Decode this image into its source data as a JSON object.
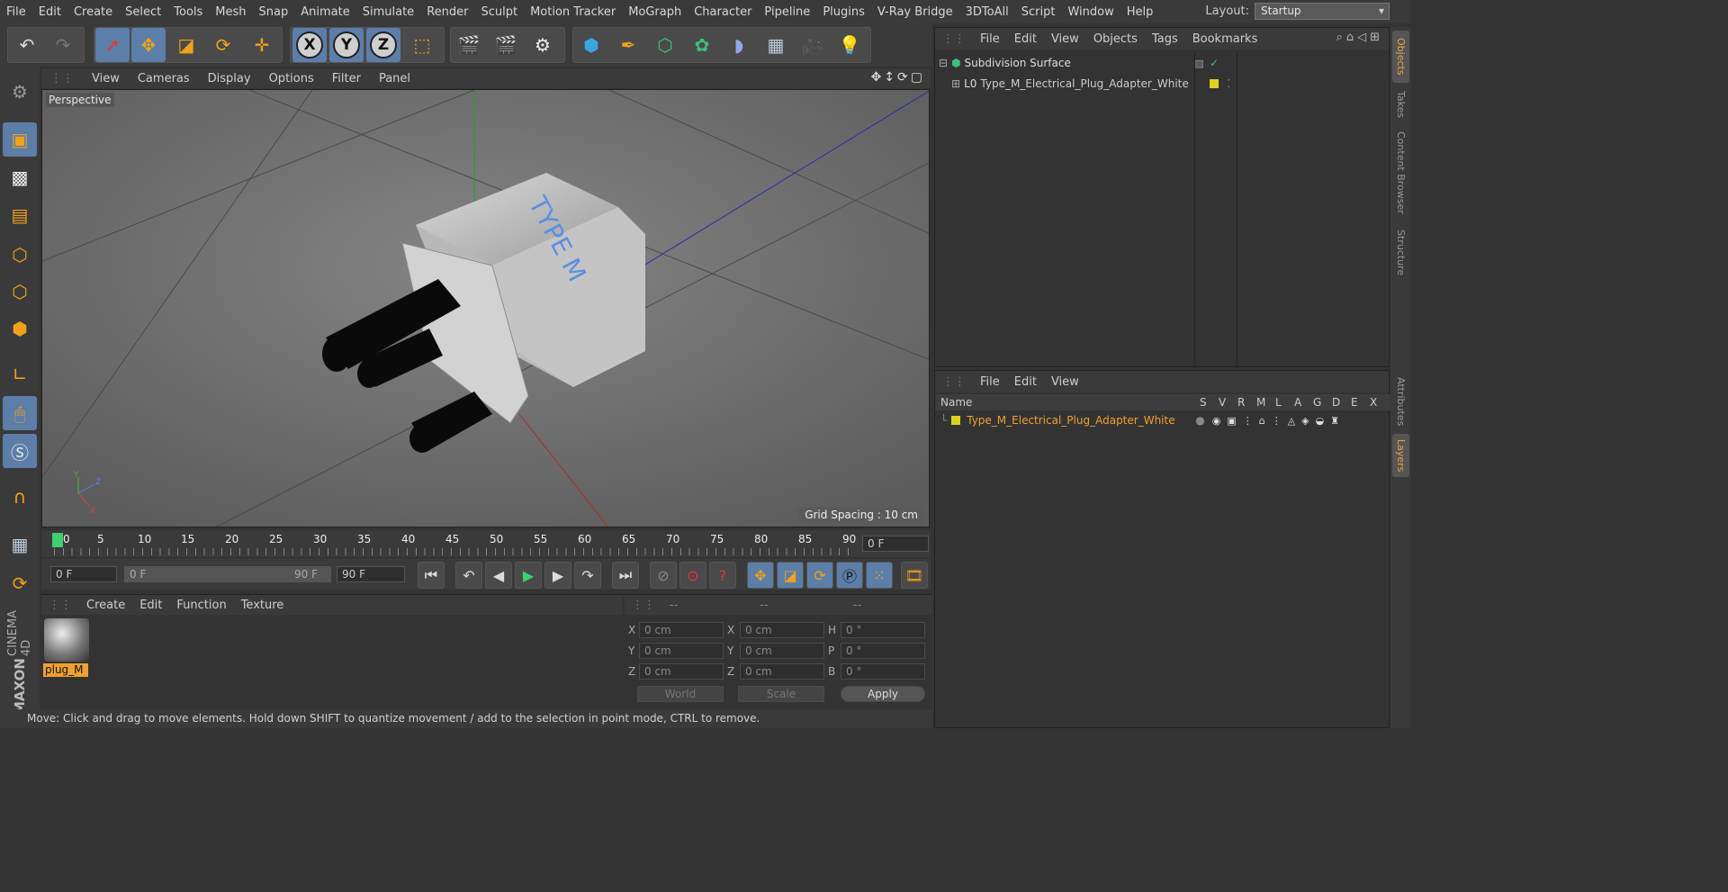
{
  "menubar": {
    "items": [
      "File",
      "Edit",
      "Create",
      "Select",
      "Tools",
      "Mesh",
      "Snap",
      "Animate",
      "Simulate",
      "Render",
      "Sculpt",
      "Motion Tracker",
      "MoGraph",
      "Character",
      "Pipeline",
      "Plugins",
      "V-Ray Bridge",
      "3DToAll",
      "Script",
      "Window",
      "Help"
    ],
    "layout_label": "Layout:",
    "layout_value": "Startup"
  },
  "viewport": {
    "menu": [
      "View",
      "Cameras",
      "Display",
      "Options",
      "Filter",
      "Panel"
    ],
    "camera_label": "Perspective",
    "grid_spacing": "Grid Spacing : 10 cm",
    "object_text": "TYPE M"
  },
  "timeline": {
    "ticks": [
      "0",
      "5",
      "10",
      "15",
      "20",
      "25",
      "30",
      "35",
      "40",
      "45",
      "50",
      "55",
      "60",
      "65",
      "70",
      "75",
      "80",
      "85",
      "90"
    ],
    "current_frame": "0 F",
    "start_frame": "0 F",
    "range_start": "0 F",
    "range_end": "90 F",
    "end_frame": "90 F"
  },
  "material_manager": {
    "menu": [
      "Create",
      "Edit",
      "Function",
      "Texture"
    ],
    "material_name": "plug_M"
  },
  "coordinates": {
    "headers": [
      "--",
      "--",
      "--"
    ],
    "rows": [
      {
        "l1": "X",
        "v1": "0 cm",
        "l2": "X",
        "v2": "0 cm",
        "l3": "H",
        "v3": "0 °"
      },
      {
        "l1": "Y",
        "v1": "0 cm",
        "l2": "Y",
        "v2": "0 cm",
        "l3": "P",
        "v3": "0 °"
      },
      {
        "l1": "Z",
        "v1": "0 cm",
        "l2": "Z",
        "v2": "0 cm",
        "l3": "B",
        "v3": "0 °"
      }
    ],
    "world": "World",
    "scale": "Scale",
    "apply": "Apply"
  },
  "status_text": "Move: Click and drag to move elements. Hold down SHIFT to quantize movement / add to the selection in point mode, CTRL to remove.",
  "object_manager": {
    "menu": [
      "File",
      "Edit",
      "View",
      "Objects",
      "Tags",
      "Bookmarks"
    ],
    "objects": [
      {
        "name": "Subdivision Surface"
      },
      {
        "name": "Type_M_Electrical_Plug_Adapter_White"
      }
    ]
  },
  "layer_manager": {
    "menu": [
      "File",
      "Edit",
      "View"
    ],
    "name_header": "Name",
    "col_headers": [
      "S",
      "V",
      "R",
      "M",
      "L",
      "A",
      "G",
      "D",
      "E",
      "X"
    ],
    "layers": [
      {
        "name": "Type_M_Electrical_Plug_Adapter_White"
      }
    ]
  },
  "side_tabs": [
    "Objects",
    "Takes",
    "Content Browser",
    "Structure",
    "Attributes",
    "Layers"
  ],
  "brand": {
    "line1": "MAXON",
    "line2": "CINEMA 4D"
  },
  "colors": {
    "accent": "#5c7ea8",
    "layer_text": "#f0a030",
    "layer_color": "#e0d020"
  }
}
